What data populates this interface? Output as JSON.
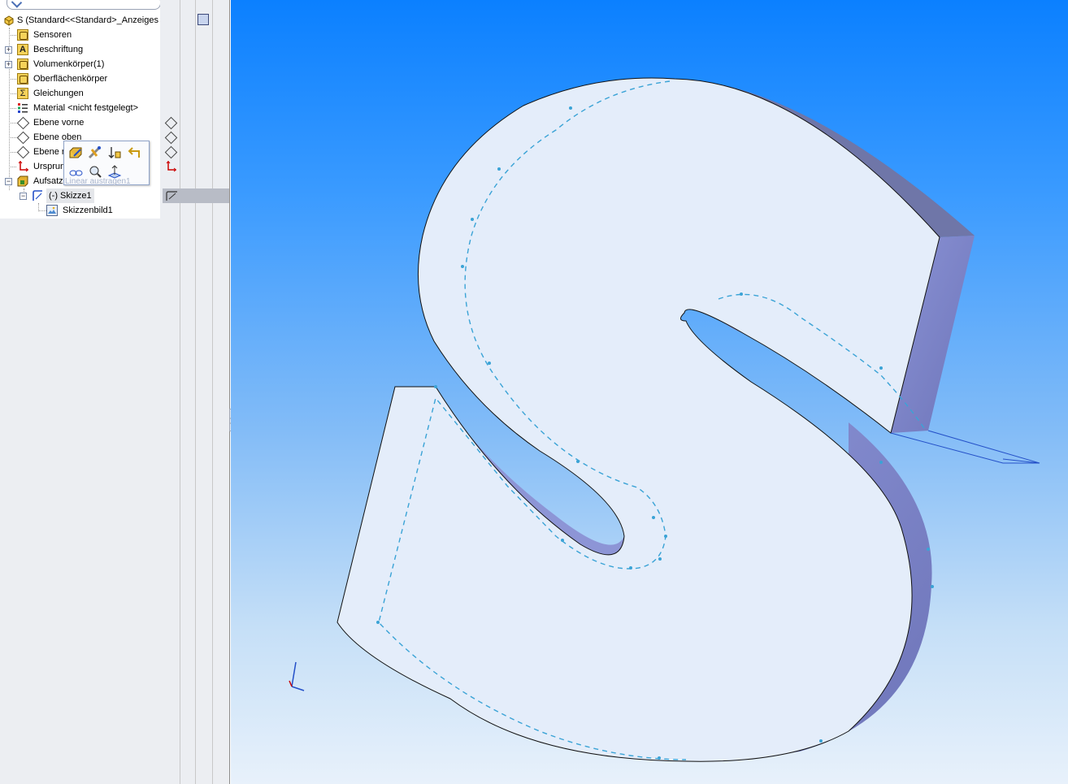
{
  "tree": {
    "root_label": "S  (Standard<<Standard>_Anzeiges",
    "items": [
      {
        "label": "Sensoren",
        "icon": "sensor-folder-icon"
      },
      {
        "label": "Beschriftung",
        "icon": "annotation-icon"
      },
      {
        "label": "Volumenkörper(1)",
        "icon": "solid-bodies-folder-icon"
      },
      {
        "label": "Oberflächenkörper",
        "icon": "surface-bodies-folder-icon"
      },
      {
        "label": "Gleichungen",
        "icon": "equations-icon"
      },
      {
        "label": "Material <nicht festgelegt>",
        "icon": "material-icon"
      },
      {
        "label": "Ebene vorne",
        "icon": "plane-icon"
      },
      {
        "label": "Ebene oben",
        "icon": "plane-icon"
      },
      {
        "label": "Ebene re",
        "icon": "plane-icon"
      },
      {
        "label": "Ursprung",
        "icon": "origin-icon"
      },
      {
        "label": "Aufsatz",
        "icon": "extrude-feature-icon"
      },
      {
        "label": "(-) Skizze1",
        "icon": "sketch-icon"
      },
      {
        "label": "Skizzenbild1",
        "icon": "sketch-picture-icon"
      }
    ]
  },
  "context_toolbar": {
    "hint": "Linear austragen1",
    "buttons": [
      "edit-feature-icon",
      "edit-sketch-icon",
      "rollback-icon",
      "parent-child-icon",
      "hide-show-icon",
      "zoom-to-selection-icon",
      "normal-to-icon",
      "select-other-icon"
    ]
  },
  "colors": {
    "viewport_top": "#0b80ff",
    "viewport_bottom": "#e8f1fb",
    "face": "#e4edfa",
    "side": "#7f87cb",
    "sketch_line": "#3aa3d6"
  }
}
